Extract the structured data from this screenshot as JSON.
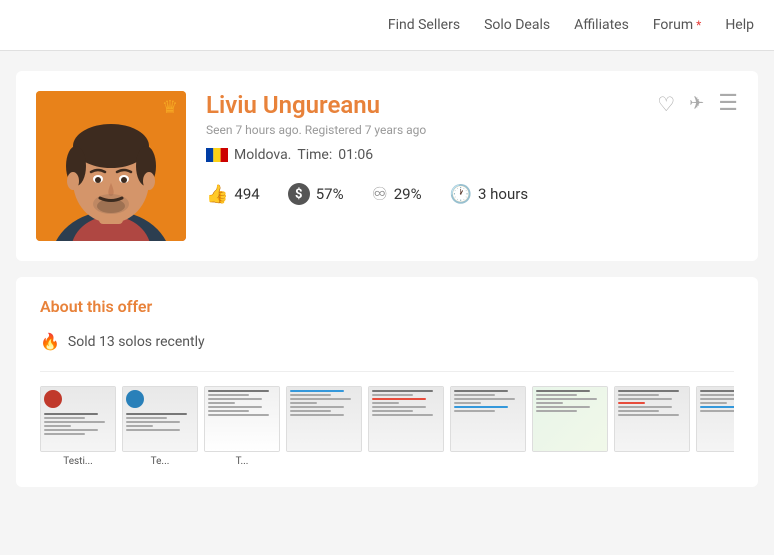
{
  "header": {
    "nav": [
      {
        "label": "Find Sellers",
        "id": "find-sellers"
      },
      {
        "label": "Solo Deals",
        "id": "solo-deals"
      },
      {
        "label": "Affiliates",
        "id": "affiliates"
      },
      {
        "label": "Forum",
        "id": "forum",
        "asterisk": true
      },
      {
        "label": "Help",
        "id": "help"
      }
    ]
  },
  "profile": {
    "name": "Liviu Ungureanu",
    "seen": "Seen 7 hours ago. Registered 7 years ago",
    "country": "Moldova.",
    "time_label": "Time:",
    "time_value": "01:06",
    "stats": [
      {
        "id": "likes",
        "value": "494"
      },
      {
        "id": "dollar",
        "value": "57%"
      },
      {
        "id": "recycle",
        "value": "29%"
      },
      {
        "id": "clock",
        "value": "3 hours"
      }
    ]
  },
  "offer": {
    "title": "About this offer",
    "sold_text": "Sold 13 solos recently"
  },
  "thumbnails": [
    {
      "label": "Testi..."
    },
    {
      "label": "Te..."
    },
    {
      "label": "T..."
    },
    {
      "label": ""
    },
    {
      "label": ""
    },
    {
      "label": ""
    },
    {
      "label": ""
    },
    {
      "label": ""
    },
    {
      "label": ""
    }
  ]
}
